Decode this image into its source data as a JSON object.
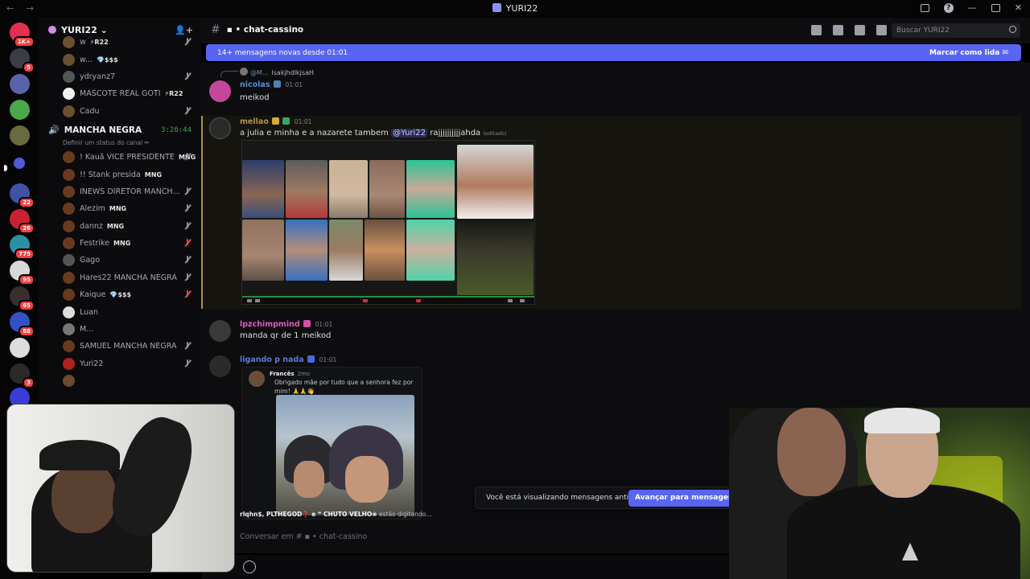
{
  "window": {
    "title": "YURI22",
    "nav_arrows": "← →"
  },
  "rail": {
    "servers": [
      {
        "badge": "1K+",
        "color": "#e0314e",
        "active": false
      },
      {
        "badge": "5",
        "color": "#3a3d44",
        "active": false
      },
      {
        "badge": "",
        "color": "#5a63a8",
        "active": false
      },
      {
        "badge": "",
        "color": "#4aa74a",
        "active": false
      },
      {
        "badge": "",
        "color": "#6a6a40",
        "active": false
      },
      {
        "badge": "",
        "color": "#4e5bd6",
        "active": true
      },
      {
        "badge": "22",
        "color": "#3f52a6",
        "active": false
      },
      {
        "badge": "26",
        "color": "#c8242f",
        "active": false
      },
      {
        "badge": "775",
        "color": "#2d8fa2",
        "active": false
      },
      {
        "badge": "95",
        "color": "#d8d8d8",
        "active": false
      },
      {
        "badge": "65",
        "color": "#3a2d2d",
        "active": false
      },
      {
        "badge": "88",
        "color": "#3551c8",
        "active": false
      },
      {
        "badge": "",
        "color": "#dddddd",
        "active": false
      },
      {
        "badge": "3",
        "color": "#2a2a2a",
        "active": false
      },
      {
        "badge": "",
        "color": "#3a3cd6",
        "active": false
      }
    ]
  },
  "sidebar": {
    "guild_name": "YURI22 ⌄",
    "top_users": [
      {
        "name": "w",
        "tag": "⚡R22",
        "color": "#6a5030",
        "mic": "muted"
      },
      {
        "name": "w...",
        "tag": "💎$$$",
        "color": "#6a5030",
        "mic": "none"
      },
      {
        "name": "ydryanz7",
        "tag": "",
        "color": "#555555",
        "mic": "muted"
      },
      {
        "name": "MASCOTE REAL GOTI",
        "tag": "⚡R22",
        "color": "#eeeeee",
        "mic": "none"
      },
      {
        "name": "Cadu",
        "tag": "",
        "color": "#6a5030",
        "mic": "muted"
      }
    ],
    "voice_channel": {
      "name": "MANCHA NEGRA",
      "timer": "3:26:44",
      "status": "Definir um status do canal ✏"
    },
    "voice_users": [
      {
        "name": "! Kauã VICE PRESIDENTE",
        "tag": "MNG",
        "color": "#6a3a20",
        "mic": "muted"
      },
      {
        "name": "!! Stank presida",
        "tag": "MNG",
        "color": "#6a3a20",
        "mic": "none"
      },
      {
        "name": "INEWS DIRETOR MANCH...",
        "tag": "",
        "color": "#6a3a20",
        "mic": "muted"
      },
      {
        "name": "Alezim",
        "tag": "MNG",
        "color": "#6a3a20",
        "mic": "muted"
      },
      {
        "name": "dannz",
        "tag": "MNG",
        "color": "#6a3a20",
        "mic": "muted"
      },
      {
        "name": "Festrike",
        "tag": "MNG",
        "color": "#6a3a20",
        "mic": "red"
      },
      {
        "name": "Gago",
        "tag": "",
        "color": "#555555",
        "mic": "muted"
      },
      {
        "name": "Hares22 MANCHA NEGRA",
        "tag": "",
        "color": "#6a3a20",
        "mic": "muted"
      },
      {
        "name": "Kaique",
        "tag": "💎$$$",
        "color": "#6a3a20",
        "mic": "red"
      },
      {
        "name": "Luan",
        "tag": "",
        "color": "#dddddd",
        "mic": "none"
      },
      {
        "name": "M...",
        "tag": "",
        "color": "#777777",
        "mic": "none"
      },
      {
        "name": "SAMUEL MANCHA NEGRA",
        "tag": "",
        "color": "#6a3a20",
        "mic": "muted"
      },
      {
        "name": "Yuri22",
        "tag": "",
        "color": "#b02020",
        "mic": "muted"
      },
      {
        "name": "",
        "tag": "",
        "color": "#6a4a30",
        "mic": "none"
      }
    ]
  },
  "header": {
    "channel": "▪ • chat-cassino",
    "search_placeholder": "Buscar YURI22"
  },
  "banner": {
    "text": "14+ mensagens novas desde 01:01",
    "action": "Marcar como lida"
  },
  "messages": {
    "m1": {
      "reply_name": "@M...",
      "reply_text": "lsakjhdlkjsaH",
      "author": "nicolas",
      "author_color": "#4e8fd6",
      "time": "01:01",
      "text": "meikod"
    },
    "m2": {
      "author": "mellao",
      "author_color": "#b6914a",
      "time": "01:01",
      "text_before": "a julia e minha e a nazarete tambem ",
      "mention": "@Yuri22",
      "text_after": " rajjjjjjjjjjahda",
      "edited": "(editado)"
    },
    "m3": {
      "author": "lpzchimpmind",
      "author_color": "#e05bbd",
      "time": "01:01",
      "text": "manda qr de 1 meikod"
    },
    "m4": {
      "author": "ligando p nada",
      "author_color": "#5a7ad8",
      "time": "01:01",
      "forward": {
        "name": "Francês",
        "time": "2mo",
        "text": "Obrigado mãe por tudo que a senhora fez por mim! 🙏🙏👋"
      }
    }
  },
  "typing": {
    "names": "rlqhn$, PLTHEGOD❓ e ❞ CHUTO VELHO❀",
    "suffix": " estão digitando..."
  },
  "old_messages": {
    "notice": "Você está visualizando mensagens antigas",
    "jump": "Avançar para mensagens recentes"
  },
  "composer": {
    "placeholder": "Conversar em # ▪ • chat-cassino"
  }
}
